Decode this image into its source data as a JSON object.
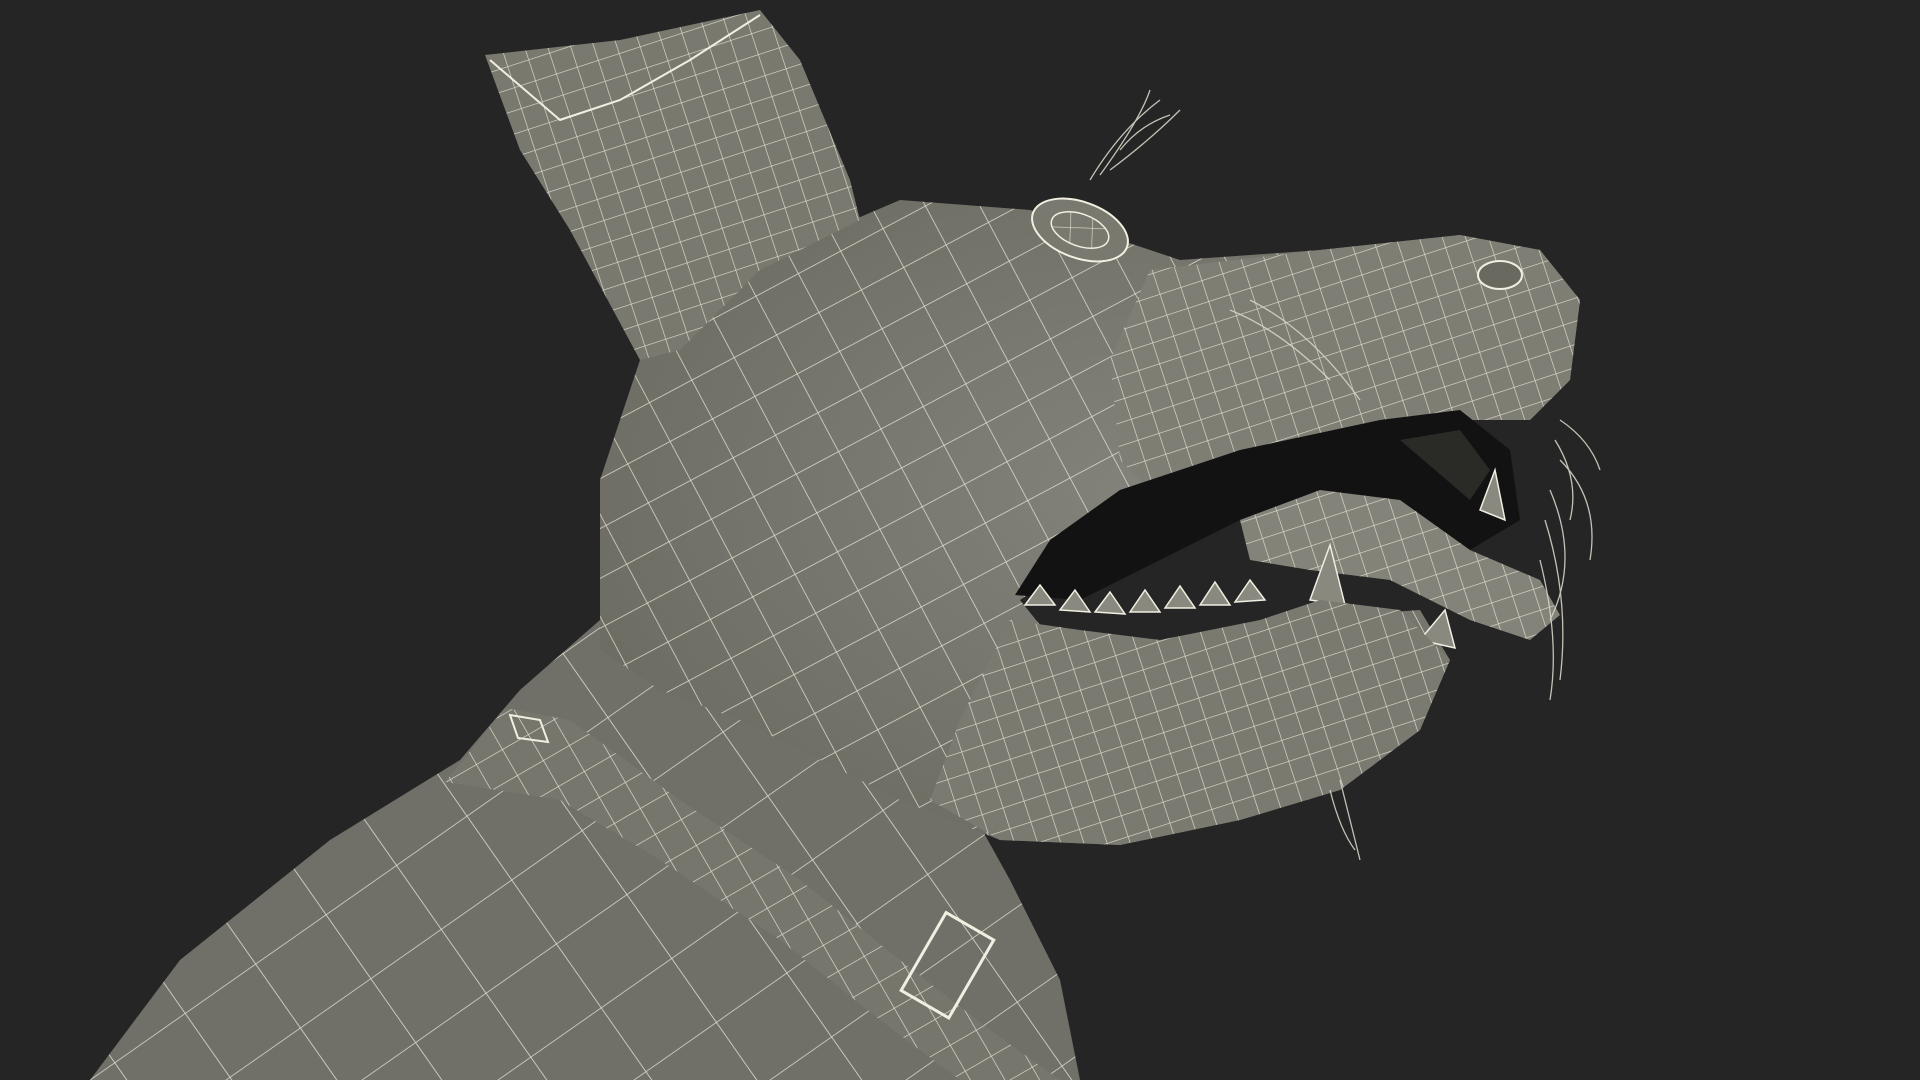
{
  "scene": {
    "subject": "dog-head-wireframe-model",
    "background_color": "#252525",
    "surface_color": "#7c7b70",
    "surface_shadow_color": "#5e5d54",
    "wire_color": "#f1efe1",
    "mouth_color": "#121212"
  }
}
